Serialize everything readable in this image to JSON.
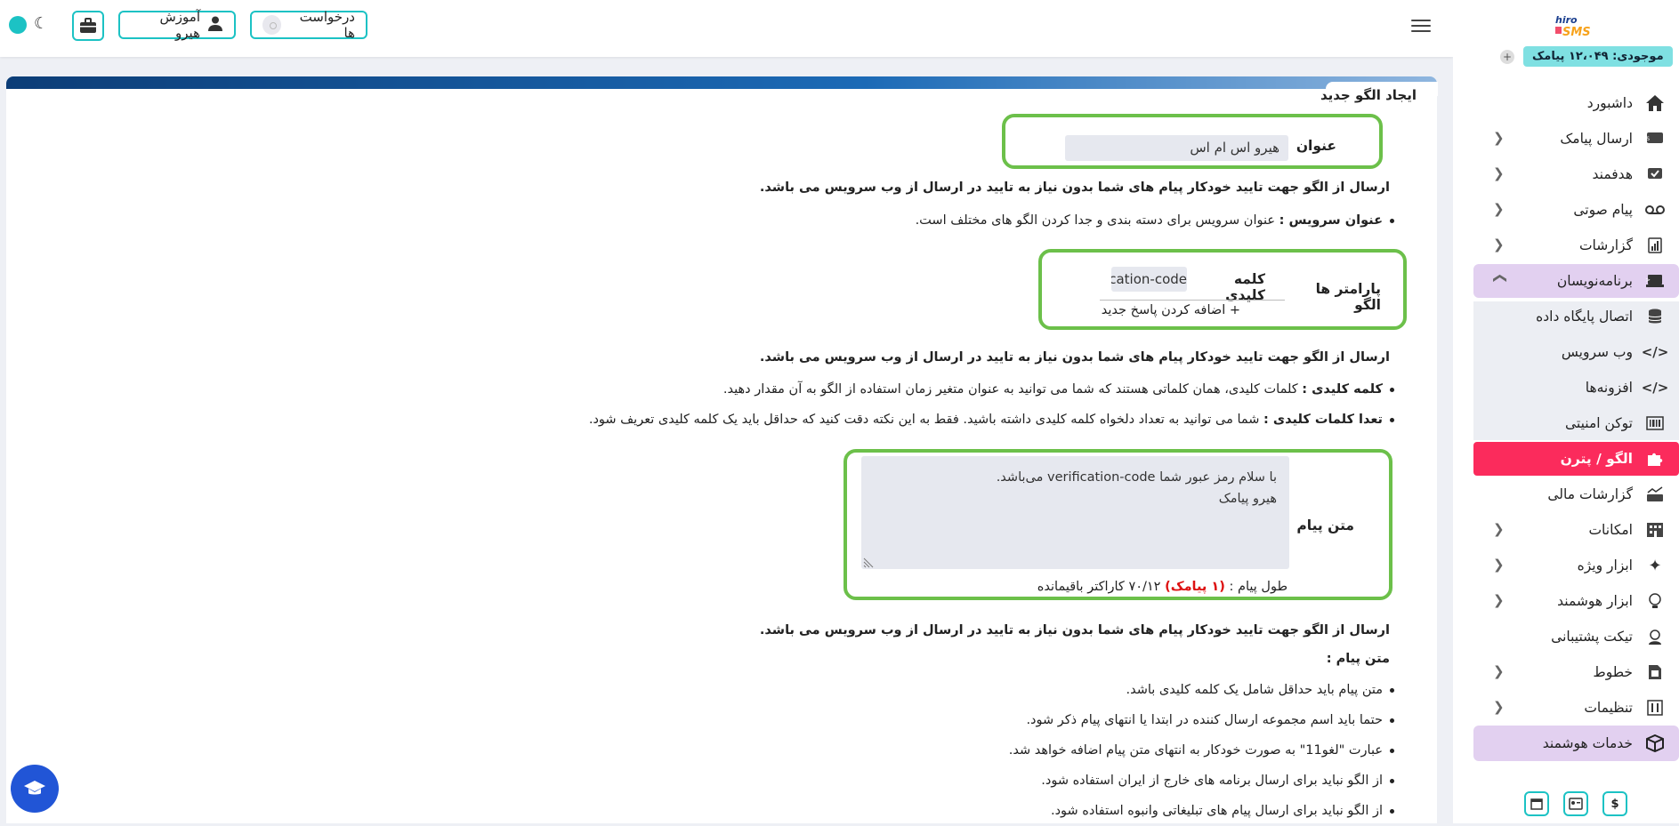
{
  "topbar": {
    "requests_label": "درخواست ها",
    "tutorial_label": "آموزش هیرو"
  },
  "sidebar": {
    "logo_text": "hiroSMS",
    "balance": "موجودی: ۱۲،۰۴۹ پیامک",
    "items": [
      {
        "label": "داشبورد"
      },
      {
        "label": "ارسال پیامک"
      },
      {
        "label": "هدفمند"
      },
      {
        "label": "پیام صوتی"
      },
      {
        "label": "گزارشات"
      },
      {
        "label": "برنامه‌نویسان"
      },
      {
        "label": "اتصال پایگاه داده"
      },
      {
        "label": "وب سرویس"
      },
      {
        "label": "افزونه‌ها"
      },
      {
        "label": "توکن امنیتی"
      },
      {
        "label": "الگو / پترن"
      },
      {
        "label": "گزارشات مالی"
      },
      {
        "label": "امکانات"
      },
      {
        "label": "ابزار ویژه"
      },
      {
        "label": "ابزار هوشمند"
      },
      {
        "label": "تیکت پشتیبانی"
      },
      {
        "label": "خطوط"
      },
      {
        "label": "تنظیمات"
      },
      {
        "label": "خدمات هوشمند"
      }
    ]
  },
  "main": {
    "title": "ایجاد الگو جدید",
    "title_field_label": "عنوان",
    "title_value": "هیرو اس ام اس",
    "info_note": "ارسال از الگو جهت تایید خودکار پیام های شما بدون نیاز به تایید در ارسال از وب سرویس می باشد.",
    "service_title_bold": "عنوان سرویس :",
    "service_title_text": " عنوان سرویس برای دسته بندی و جدا کردن الگو های مختلف است.",
    "params_label": "پارامتر ها الگو",
    "keyword_label": "کلمه کلیدی",
    "keyword_value": "verification-code",
    "add_response": "+ اضافه کردن پاسخ جدید",
    "keyword_bold": "کلمه کلیدی :",
    "keyword_text": " کلمات کلیدی، همان کلماتی هستند که شما می توانید به عنوان متغیر زمان استفاده از الگو به آن مقدار دهید.",
    "count_bold": "تعدا کلمات کلیدی :",
    "count_text": " شما می توانید به تعداد دلخواه کلمه کلیدی داشته باشید. فقط به این نکته دقت کنید که حداقل باید یک کلمه کلیدی تعریف شود.",
    "message_label": "متن پیام",
    "message_line1": "با سلام رمز عبور شما verification-code می‌باشد.",
    "message_line2": "هیرو پیامک",
    "length_prefix": "طول پیام : ",
    "length_count": "(۱ پیامک)",
    "length_suffix": " ۷۰/۱۲ کاراکتر باقیمانده",
    "rules_heading": "متن پیام :",
    "rules": [
      "متن پیام باید حداقل شامل یک کلمه کلیدی باشد.",
      "حتما باید اسم مجموعه ارسال کننده در ابتدا یا انتهای پیام ذکر شود.",
      "عبارت \"لغو11\" به صورت خودکار به انتهای متن پیام اضافه خواهد شد.",
      "از الگو نباید برای ارسال برنامه های خارج از ایران استفاده شود.",
      "از الگو نباید برای ارسال پیام های تبلیغاتی وانبوه استفاده شود."
    ]
  },
  "colors": {
    "accent": "#1cc2c4",
    "active_nav": "#fb2b5c",
    "highlight_nav": "#e2d0f0",
    "green_frame": "#6cc04a"
  }
}
